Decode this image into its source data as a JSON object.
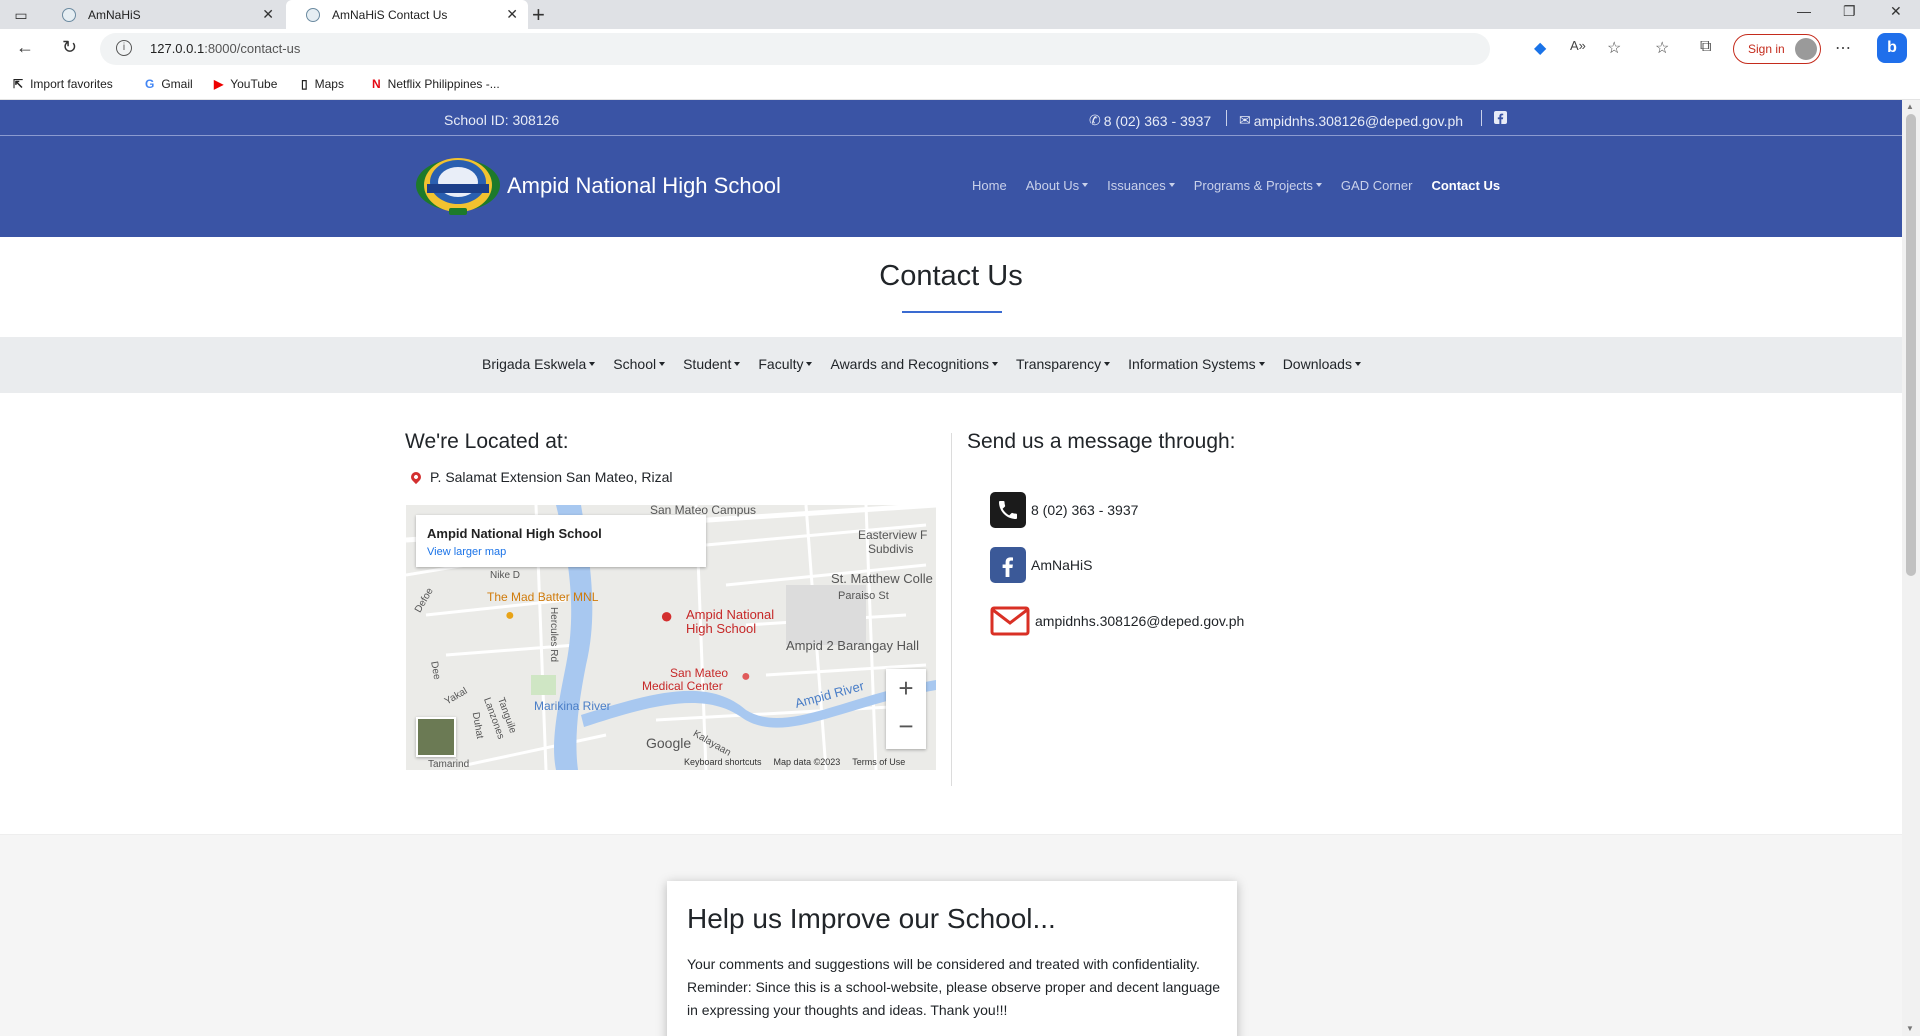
{
  "browser": {
    "tabs": [
      {
        "title": "AmNaHiS",
        "active": false
      },
      {
        "title": "AmNaHiS Contact Us",
        "active": true
      }
    ],
    "url_host": "127.0.0.1",
    "url_rest": ":8000/contact-us",
    "signin_label": "Sign in",
    "bookmarks": [
      {
        "label": "Import favorites",
        "icon": "import-icon"
      },
      {
        "label": "Gmail",
        "icon": "google-icon"
      },
      {
        "label": "YouTube",
        "icon": "youtube-icon"
      },
      {
        "label": "Maps",
        "icon": "page-icon"
      },
      {
        "label": "Netflix Philippines -...",
        "icon": "netflix-icon"
      }
    ]
  },
  "topbar": {
    "school_id": "School ID: 308126",
    "phone": "8 (02) 363 - 3937",
    "email": "ampidnhs.308126@deped.gov.ph"
  },
  "header": {
    "brand": "Ampid National High School",
    "nav": [
      {
        "label": "Home",
        "dropdown": false,
        "active": false
      },
      {
        "label": "About Us",
        "dropdown": true,
        "active": false
      },
      {
        "label": "Issuances",
        "dropdown": true,
        "active": false
      },
      {
        "label": "Programs & Projects",
        "dropdown": true,
        "active": false
      },
      {
        "label": "GAD Corner",
        "dropdown": false,
        "active": false
      },
      {
        "label": "Contact Us",
        "dropdown": false,
        "active": true
      }
    ]
  },
  "page_title": "Contact Us",
  "subnav": [
    "Brigada Eskwela",
    "School",
    "Student",
    "Faculty",
    "Awards and Recognitions",
    "Transparency",
    "Information Systems",
    "Downloads"
  ],
  "location": {
    "heading": "We're Located at:",
    "address": "P. Salamat Extension San Mateo, Rizal"
  },
  "map": {
    "place_name": "Ampid National High School",
    "larger_map_link": "View larger map",
    "labels": {
      "campus": "San Mateo Campus",
      "eastview": "Easterview F",
      "subdiv": "Subdivis",
      "church": "St. Matthew Colle",
      "paraiso": "Paraiso St",
      "batter": "The Mad Batter MNL",
      "school1": "Ampid National",
      "school2": "High School",
      "brgy": "Ampid 2 Barangay Hall",
      "hospital1": "San Mateo",
      "hospital2": "Medical Center",
      "river1": "Marikina River",
      "river2": "Ampid River",
      "hercules": "Hercules Rd",
      "tanguile": "Tanguile",
      "lanzones": "Lanzones",
      "yakal": "Yakal",
      "duhat": "Duhat",
      "dee": "Dee",
      "defoe": "Defoe",
      "nike": "Nike D",
      "tamarind": "Tamarind",
      "kalayaan": "Kalayaan",
      "google": "Google"
    },
    "footer": [
      "Keyboard shortcuts",
      "Map data ©2023",
      "Terms of Use"
    ]
  },
  "message": {
    "heading": "Send us a message through:",
    "phone": "8 (02) 363 - 3937",
    "facebook": "AmNaHiS",
    "email": "ampidnhs.308126@deped.gov.ph"
  },
  "feedback": {
    "title": "Help us Improve our School...",
    "text": "Your comments and suggestions will be considered and treated with confidentiality. Reminder: Since this is a school-website, please observe proper and decent language in expressing your thoughts and ideas. Thank you!!!"
  },
  "colors": {
    "brand_blue": "#3a54a5",
    "accent_line": "#3a6bd1",
    "pin_red": "#d32f2f"
  }
}
